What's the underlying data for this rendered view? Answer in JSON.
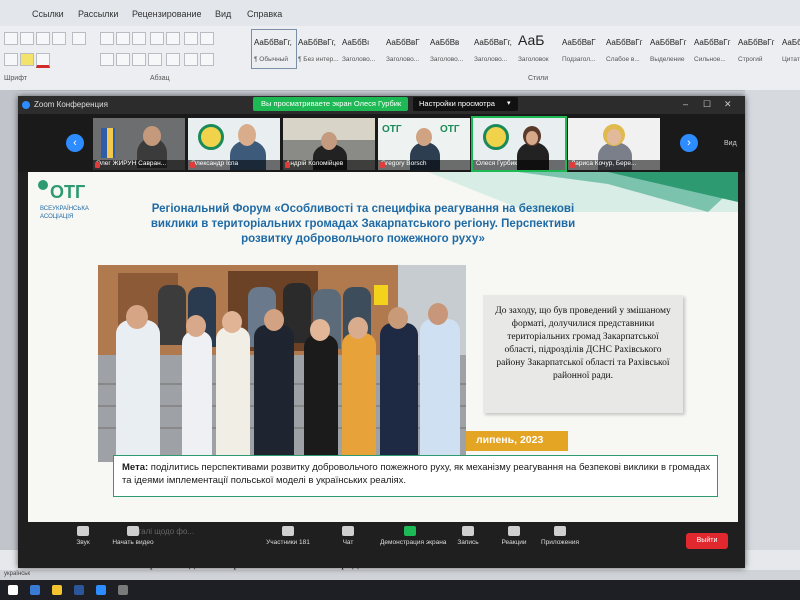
{
  "word": {
    "tabs": [
      "Ссылки",
      "Рассылки",
      "Рецензирование",
      "Вид",
      "Справка"
    ],
    "groups": {
      "paragraph": "Абзац",
      "styles": "Стили",
      "font_abbr": "Шрифт"
    },
    "styles": [
      {
        "sample": "АаБбВвГг,",
        "name": "¶ Обычный"
      },
      {
        "sample": "АаБбВвГг,",
        "name": "¶ Без интер..."
      },
      {
        "sample": "АаБбВı",
        "name": "Заголово..."
      },
      {
        "sample": "АаБбВвГ",
        "name": "Заголово..."
      },
      {
        "sample": "АаБбВв",
        "name": "Заголово..."
      },
      {
        "sample": "АаБбВвГг,",
        "name": "Заголово..."
      },
      {
        "sample": "АаБ",
        "name": "Заголовок"
      },
      {
        "sample": "АаБбВвГ",
        "name": "Подзагол..."
      },
      {
        "sample": "АаБбВвГг",
        "name": "Слабое в..."
      },
      {
        "sample": "АаБбВвГг",
        "name": "Выделение"
      },
      {
        "sample": "АаБбВвГг",
        "name": "Сильное..."
      },
      {
        "sample": "АаБбВвГг",
        "name": "Строгий"
      },
      {
        "sample": "АаБбВвГ",
        "name": "Цитата"
      }
    ],
    "doc_text": "Пленарне засідання чергової 38-ої сесійної ради VIII скликання",
    "status_left": "українськ"
  },
  "zoom": {
    "title": "Zoom Конференция",
    "share_banner": "Вы просматриваете экран Олеся Гурбик",
    "view_options": "Настройки просмотра",
    "view_label": "Вид",
    "participants": [
      {
        "name": "Олег ЖИРУН Савран..."
      },
      {
        "name": "Олександр Іспа"
      },
      {
        "name": "Андрій Коломійцев"
      },
      {
        "name": "Gregory Borsch"
      },
      {
        "name": "Олеся Гурбик"
      },
      {
        "name": "Лариса Кочур, Бере..."
      }
    ],
    "toolbar": [
      {
        "label": "Звук"
      },
      {
        "label": "Начать видео"
      },
      {
        "label": "Участники",
        "count": "181"
      },
      {
        "label": "Чат"
      },
      {
        "label": "Демонстрация экрана"
      },
      {
        "label": "Запись"
      },
      {
        "label": "Реакции"
      },
      {
        "label": "Приложения"
      }
    ],
    "leave": "Выйти"
  },
  "slide": {
    "logo_text": "ОТГ",
    "logo_sub1": "ВСЕУКРАЇНСЬКА",
    "logo_sub2": "АСОЦІАЦІЯ",
    "title": "Регіональний Форум «Особливості та специфіка реагування на безпекові виклики в територіальних громадах Закарпатського регіону. Перспективи розвитку добровольчого пожежного руху»",
    "info": "До заходу, що був проведений у змішаному форматі, долучилися представники територіальних громад Закарпатської області, підрозділів ДСНС Рахівського району Закарпатської області та Рахівської районної ради.",
    "date": "липень, 2023",
    "goal_label": "Мета:",
    "goal_text": " поділитись перспективами розвитку добровольчого пожежного руху, як механізму реагування на безпекові виклики в громадах та ідеями імплементації польської моделі в українських реаліях.",
    "bleed_text": "Деталі щодо фо..."
  },
  "colors": {
    "title_blue": "#1f6aa5",
    "accent_teal": "#2e9a72",
    "date_orange": "#e5a524",
    "zoom_blue": "#2d8cff",
    "leave_red": "#e0282e"
  }
}
